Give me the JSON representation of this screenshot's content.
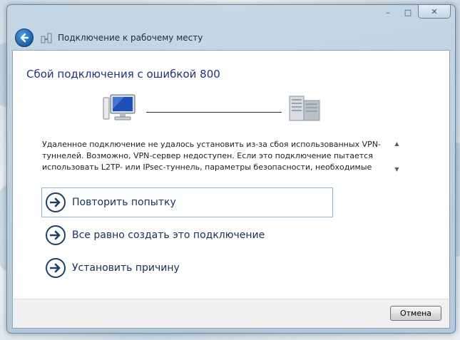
{
  "window": {
    "title": "Подключение к рабочему месту",
    "caption_buttons": {
      "minimize": "–",
      "maximize": "□",
      "close": "✕"
    }
  },
  "main": {
    "heading": "Сбой подключения с ошибкой 800",
    "error_message": "Удаленное подключение не удалось установить из-за сбоя использованных VPN-туннелей. Возможно, VPN-сервер недоступен. Если это подключение пытается использовать L2TP- или IPsec-туннель, параметры безопасности, необходимые для",
    "scroll_up": "▲",
    "scroll_down": "▼",
    "options": [
      {
        "label": "Повторить попытку"
      },
      {
        "label": "Все равно создать это подключение"
      },
      {
        "label": "Установить причину"
      }
    ]
  },
  "footer": {
    "cancel_label": "Отмена"
  },
  "icons": {
    "back": "back-arrow-icon",
    "title": "network-icon",
    "computer": "computer-icon",
    "server": "server-icon",
    "option_arrow": "arrow-right-icon"
  },
  "colors": {
    "heading": "#1e3287",
    "option_text": "#15305c",
    "frame": "#b4c8d8"
  }
}
